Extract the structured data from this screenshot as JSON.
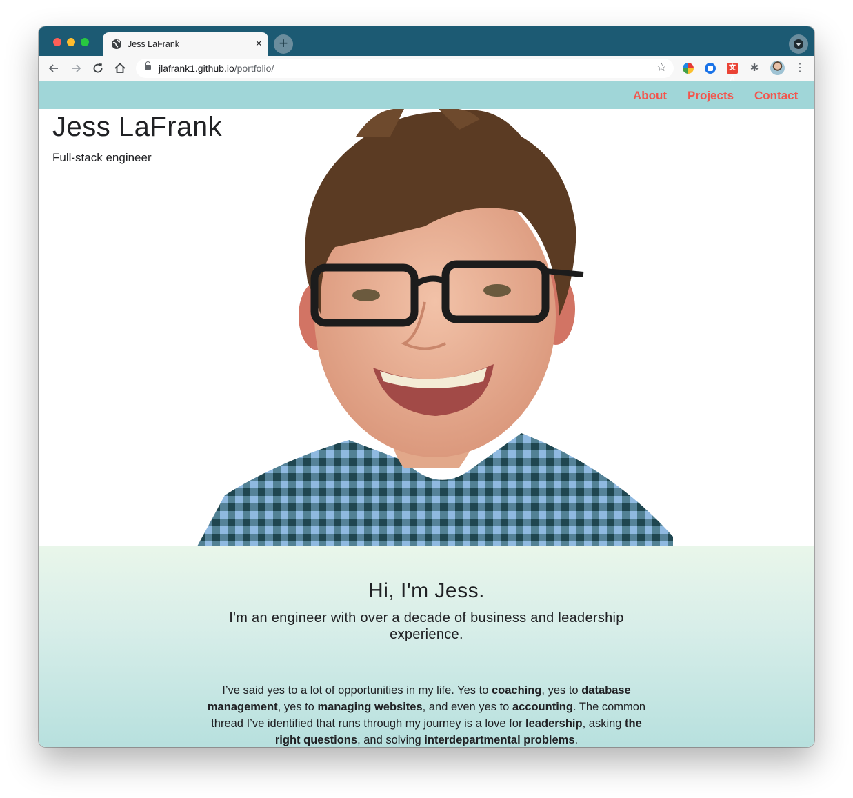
{
  "browser": {
    "tab_title": "Jess LaFrank",
    "tab_close": "×",
    "new_tab": "+",
    "url_host": "jlafrank1.github.io",
    "url_path": "/portfolio/",
    "star": "☆",
    "ext_red_label": "文A",
    "puzzle": "✱",
    "menu": "⋮",
    "icons": [
      "globe-icon",
      "back-icon",
      "forward-icon",
      "reload-icon",
      "home-icon",
      "lock-icon",
      "star-icon",
      "extension-icon",
      "profile-avatar"
    ]
  },
  "nav": {
    "about": "About",
    "projects": "Projects",
    "contact": "Contact",
    "link_color": "#f3554d",
    "bar_color": "#a0d6d8"
  },
  "hero": {
    "title": "Jess LaFrank",
    "tagline": "Full-stack engineer"
  },
  "intro": {
    "heading": "Hi, I'm Jess.",
    "subheading": "I'm an engineer with over a decade of business and leadership experience.",
    "body": [
      {
        "t": "I’ve said yes to a lot of opportunities in my life. Yes to ",
        "b": false
      },
      {
        "t": "coaching",
        "b": true
      },
      {
        "t": ", yes to ",
        "b": false
      },
      {
        "t": "database management",
        "b": true
      },
      {
        "t": ", yes to ",
        "b": false
      },
      {
        "t": "managing websites",
        "b": true
      },
      {
        "t": ", and even yes to ",
        "b": false
      },
      {
        "t": "accounting",
        "b": true
      },
      {
        "t": ". The common thread I’ve identified that runs through my journey is a love for ",
        "b": false
      },
      {
        "t": "leadership",
        "b": true
      },
      {
        "t": ", asking ",
        "b": false
      },
      {
        "t": "the right questions",
        "b": true
      },
      {
        "t": ", and solving ",
        "b": false
      },
      {
        "t": "interdepartmental problems",
        "b": true
      },
      {
        "t": ".",
        "b": false
      }
    ]
  }
}
